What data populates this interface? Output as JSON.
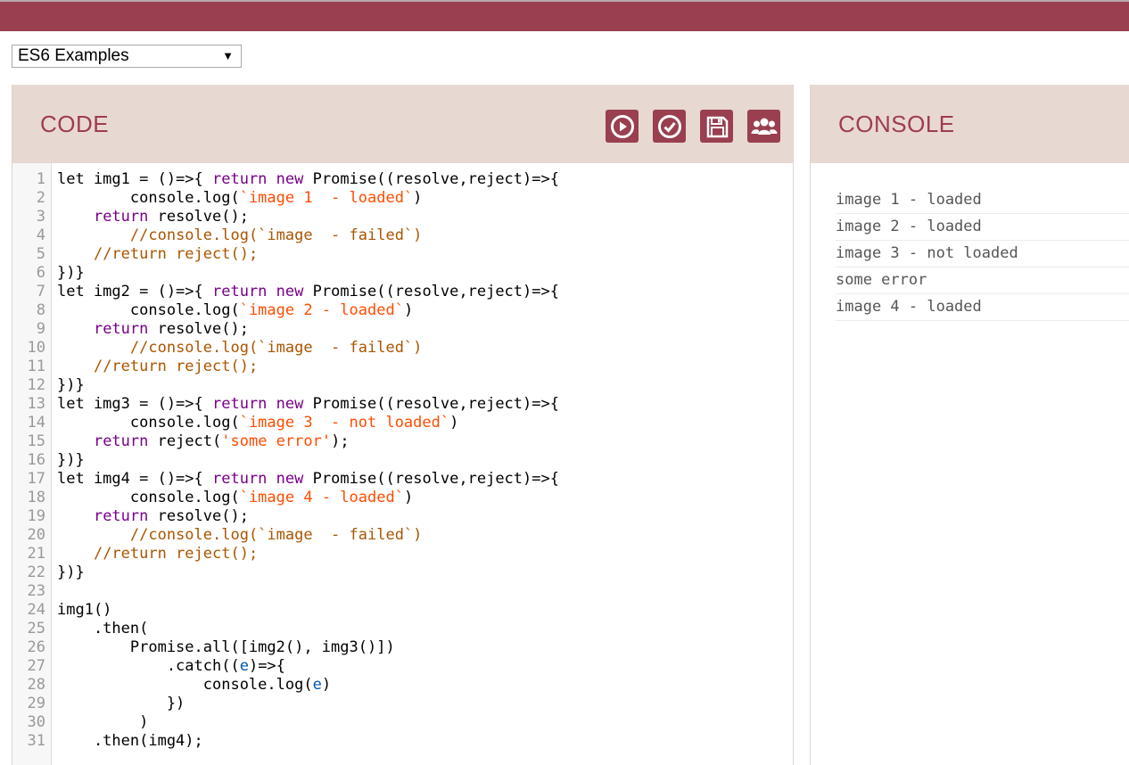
{
  "header": {
    "color": "#993f50"
  },
  "selector": {
    "value": "ES6 Examples"
  },
  "code_panel": {
    "title": "CODE",
    "toolbar": [
      {
        "name": "run-icon"
      },
      {
        "name": "check-icon"
      },
      {
        "name": "save-icon"
      },
      {
        "name": "users-icon"
      }
    ]
  },
  "console_panel": {
    "title": "CONSOLE",
    "lines": [
      "image 1 - loaded",
      "image 2 - loaded",
      "image 3 - not loaded",
      "some error",
      "image 4 - loaded"
    ]
  },
  "code": [
    [
      [
        "",
        "let img1 = ()=>{ "
      ],
      [
        "kw",
        "return"
      ],
      [
        "",
        " "
      ],
      [
        "kw",
        "new"
      ],
      [
        "",
        " Promise((resolve,reject)=>{"
      ]
    ],
    [
      [
        "",
        "        console.log("
      ],
      [
        "str",
        "`image 1  - loaded`"
      ],
      [
        "",
        ")"
      ]
    ],
    [
      [
        "",
        "    "
      ],
      [
        "kw",
        "return"
      ],
      [
        "",
        " resolve();"
      ]
    ],
    [
      [
        "",
        "        "
      ],
      [
        "cm",
        "//console.log(`image  - failed`)"
      ]
    ],
    [
      [
        "",
        "    "
      ],
      [
        "cm",
        "//return reject();"
      ]
    ],
    [
      [
        "",
        "})}"
      ]
    ],
    [
      [
        "",
        "let img2 = ()=>{ "
      ],
      [
        "kw",
        "return"
      ],
      [
        "",
        " "
      ],
      [
        "kw",
        "new"
      ],
      [
        "",
        " Promise((resolve,reject)=>{"
      ]
    ],
    [
      [
        "",
        "        console.log("
      ],
      [
        "str",
        "`image 2 - loaded`"
      ],
      [
        "",
        ")"
      ]
    ],
    [
      [
        "",
        "    "
      ],
      [
        "kw",
        "return"
      ],
      [
        "",
        " resolve();"
      ]
    ],
    [
      [
        "",
        "        "
      ],
      [
        "cm",
        "//console.log(`image  - failed`)"
      ]
    ],
    [
      [
        "",
        "    "
      ],
      [
        "cm",
        "//return reject();"
      ]
    ],
    [
      [
        "",
        "})}"
      ]
    ],
    [
      [
        "",
        "let img3 = ()=>{ "
      ],
      [
        "kw",
        "return"
      ],
      [
        "",
        " "
      ],
      [
        "kw",
        "new"
      ],
      [
        "",
        " Promise((resolve,reject)=>{"
      ]
    ],
    [
      [
        "",
        "        console.log("
      ],
      [
        "str",
        "`image 3  - not loaded`"
      ],
      [
        "",
        ")"
      ]
    ],
    [
      [
        "",
        "    "
      ],
      [
        "kw",
        "return"
      ],
      [
        "",
        " reject("
      ],
      [
        "str",
        "'some error'"
      ],
      [
        "",
        ");"
      ]
    ],
    [
      [
        "",
        "})}"
      ]
    ],
    [
      [
        "",
        "let img4 = ()=>{ "
      ],
      [
        "kw",
        "return"
      ],
      [
        "",
        " "
      ],
      [
        "kw",
        "new"
      ],
      [
        "",
        " Promise((resolve,reject)=>{"
      ]
    ],
    [
      [
        "",
        "        console.log("
      ],
      [
        "str",
        "`image 4 - loaded`"
      ],
      [
        "",
        ")"
      ]
    ],
    [
      [
        "",
        "    "
      ],
      [
        "kw",
        "return"
      ],
      [
        "",
        " resolve();"
      ]
    ],
    [
      [
        "",
        "        "
      ],
      [
        "cm",
        "//console.log(`image  - failed`)"
      ]
    ],
    [
      [
        "",
        "    "
      ],
      [
        "cm",
        "//return reject();"
      ]
    ],
    [
      [
        "",
        "})}"
      ]
    ],
    [
      [
        "",
        ""
      ]
    ],
    [
      [
        "",
        "img1()"
      ]
    ],
    [
      [
        "",
        "    .then("
      ]
    ],
    [
      [
        "",
        "        Promise.all([img2(), img3()])"
      ]
    ],
    [
      [
        "",
        "            .catch(("
      ],
      [
        "var2",
        "e"
      ],
      [
        "",
        ")=>{"
      ]
    ],
    [
      [
        "",
        "                console.log("
      ],
      [
        "var2",
        "e"
      ],
      [
        "",
        ")"
      ]
    ],
    [
      [
        "",
        "            })"
      ]
    ],
    [
      [
        "",
        "         )"
      ]
    ],
    [
      [
        "",
        "    .then(img4);"
      ]
    ]
  ]
}
